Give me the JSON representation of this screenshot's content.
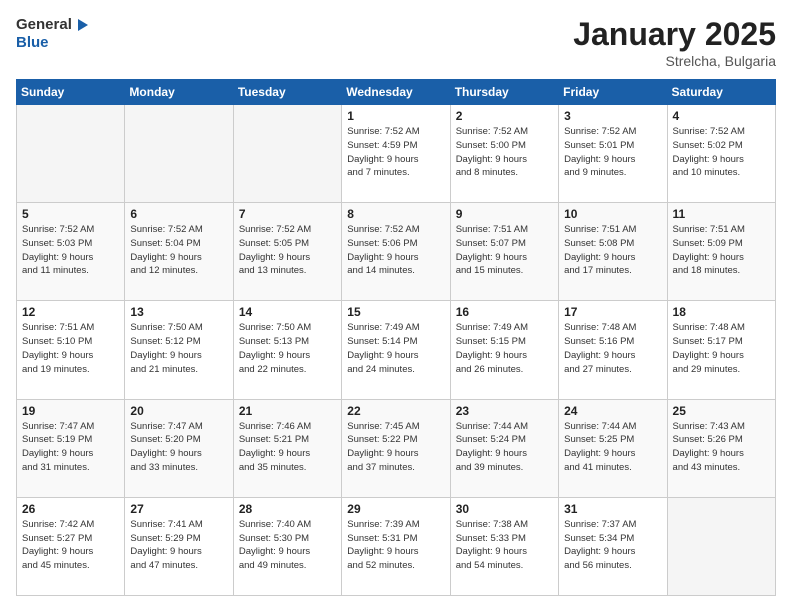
{
  "logo": {
    "general": "General",
    "blue": "Blue"
  },
  "header": {
    "month": "January 2025",
    "location": "Strelcha, Bulgaria"
  },
  "days": [
    "Sunday",
    "Monday",
    "Tuesday",
    "Wednesday",
    "Thursday",
    "Friday",
    "Saturday"
  ],
  "weeks": [
    [
      {
        "day": "",
        "content": ""
      },
      {
        "day": "",
        "content": ""
      },
      {
        "day": "",
        "content": ""
      },
      {
        "day": "1",
        "content": "Sunrise: 7:52 AM\nSunset: 4:59 PM\nDaylight: 9 hours\nand 7 minutes."
      },
      {
        "day": "2",
        "content": "Sunrise: 7:52 AM\nSunset: 5:00 PM\nDaylight: 9 hours\nand 8 minutes."
      },
      {
        "day": "3",
        "content": "Sunrise: 7:52 AM\nSunset: 5:01 PM\nDaylight: 9 hours\nand 9 minutes."
      },
      {
        "day": "4",
        "content": "Sunrise: 7:52 AM\nSunset: 5:02 PM\nDaylight: 9 hours\nand 10 minutes."
      }
    ],
    [
      {
        "day": "5",
        "content": "Sunrise: 7:52 AM\nSunset: 5:03 PM\nDaylight: 9 hours\nand 11 minutes."
      },
      {
        "day": "6",
        "content": "Sunrise: 7:52 AM\nSunset: 5:04 PM\nDaylight: 9 hours\nand 12 minutes."
      },
      {
        "day": "7",
        "content": "Sunrise: 7:52 AM\nSunset: 5:05 PM\nDaylight: 9 hours\nand 13 minutes."
      },
      {
        "day": "8",
        "content": "Sunrise: 7:52 AM\nSunset: 5:06 PM\nDaylight: 9 hours\nand 14 minutes."
      },
      {
        "day": "9",
        "content": "Sunrise: 7:51 AM\nSunset: 5:07 PM\nDaylight: 9 hours\nand 15 minutes."
      },
      {
        "day": "10",
        "content": "Sunrise: 7:51 AM\nSunset: 5:08 PM\nDaylight: 9 hours\nand 17 minutes."
      },
      {
        "day": "11",
        "content": "Sunrise: 7:51 AM\nSunset: 5:09 PM\nDaylight: 9 hours\nand 18 minutes."
      }
    ],
    [
      {
        "day": "12",
        "content": "Sunrise: 7:51 AM\nSunset: 5:10 PM\nDaylight: 9 hours\nand 19 minutes."
      },
      {
        "day": "13",
        "content": "Sunrise: 7:50 AM\nSunset: 5:12 PM\nDaylight: 9 hours\nand 21 minutes."
      },
      {
        "day": "14",
        "content": "Sunrise: 7:50 AM\nSunset: 5:13 PM\nDaylight: 9 hours\nand 22 minutes."
      },
      {
        "day": "15",
        "content": "Sunrise: 7:49 AM\nSunset: 5:14 PM\nDaylight: 9 hours\nand 24 minutes."
      },
      {
        "day": "16",
        "content": "Sunrise: 7:49 AM\nSunset: 5:15 PM\nDaylight: 9 hours\nand 26 minutes."
      },
      {
        "day": "17",
        "content": "Sunrise: 7:48 AM\nSunset: 5:16 PM\nDaylight: 9 hours\nand 27 minutes."
      },
      {
        "day": "18",
        "content": "Sunrise: 7:48 AM\nSunset: 5:17 PM\nDaylight: 9 hours\nand 29 minutes."
      }
    ],
    [
      {
        "day": "19",
        "content": "Sunrise: 7:47 AM\nSunset: 5:19 PM\nDaylight: 9 hours\nand 31 minutes."
      },
      {
        "day": "20",
        "content": "Sunrise: 7:47 AM\nSunset: 5:20 PM\nDaylight: 9 hours\nand 33 minutes."
      },
      {
        "day": "21",
        "content": "Sunrise: 7:46 AM\nSunset: 5:21 PM\nDaylight: 9 hours\nand 35 minutes."
      },
      {
        "day": "22",
        "content": "Sunrise: 7:45 AM\nSunset: 5:22 PM\nDaylight: 9 hours\nand 37 minutes."
      },
      {
        "day": "23",
        "content": "Sunrise: 7:44 AM\nSunset: 5:24 PM\nDaylight: 9 hours\nand 39 minutes."
      },
      {
        "day": "24",
        "content": "Sunrise: 7:44 AM\nSunset: 5:25 PM\nDaylight: 9 hours\nand 41 minutes."
      },
      {
        "day": "25",
        "content": "Sunrise: 7:43 AM\nSunset: 5:26 PM\nDaylight: 9 hours\nand 43 minutes."
      }
    ],
    [
      {
        "day": "26",
        "content": "Sunrise: 7:42 AM\nSunset: 5:27 PM\nDaylight: 9 hours\nand 45 minutes."
      },
      {
        "day": "27",
        "content": "Sunrise: 7:41 AM\nSunset: 5:29 PM\nDaylight: 9 hours\nand 47 minutes."
      },
      {
        "day": "28",
        "content": "Sunrise: 7:40 AM\nSunset: 5:30 PM\nDaylight: 9 hours\nand 49 minutes."
      },
      {
        "day": "29",
        "content": "Sunrise: 7:39 AM\nSunset: 5:31 PM\nDaylight: 9 hours\nand 52 minutes."
      },
      {
        "day": "30",
        "content": "Sunrise: 7:38 AM\nSunset: 5:33 PM\nDaylight: 9 hours\nand 54 minutes."
      },
      {
        "day": "31",
        "content": "Sunrise: 7:37 AM\nSunset: 5:34 PM\nDaylight: 9 hours\nand 56 minutes."
      },
      {
        "day": "",
        "content": ""
      }
    ]
  ]
}
